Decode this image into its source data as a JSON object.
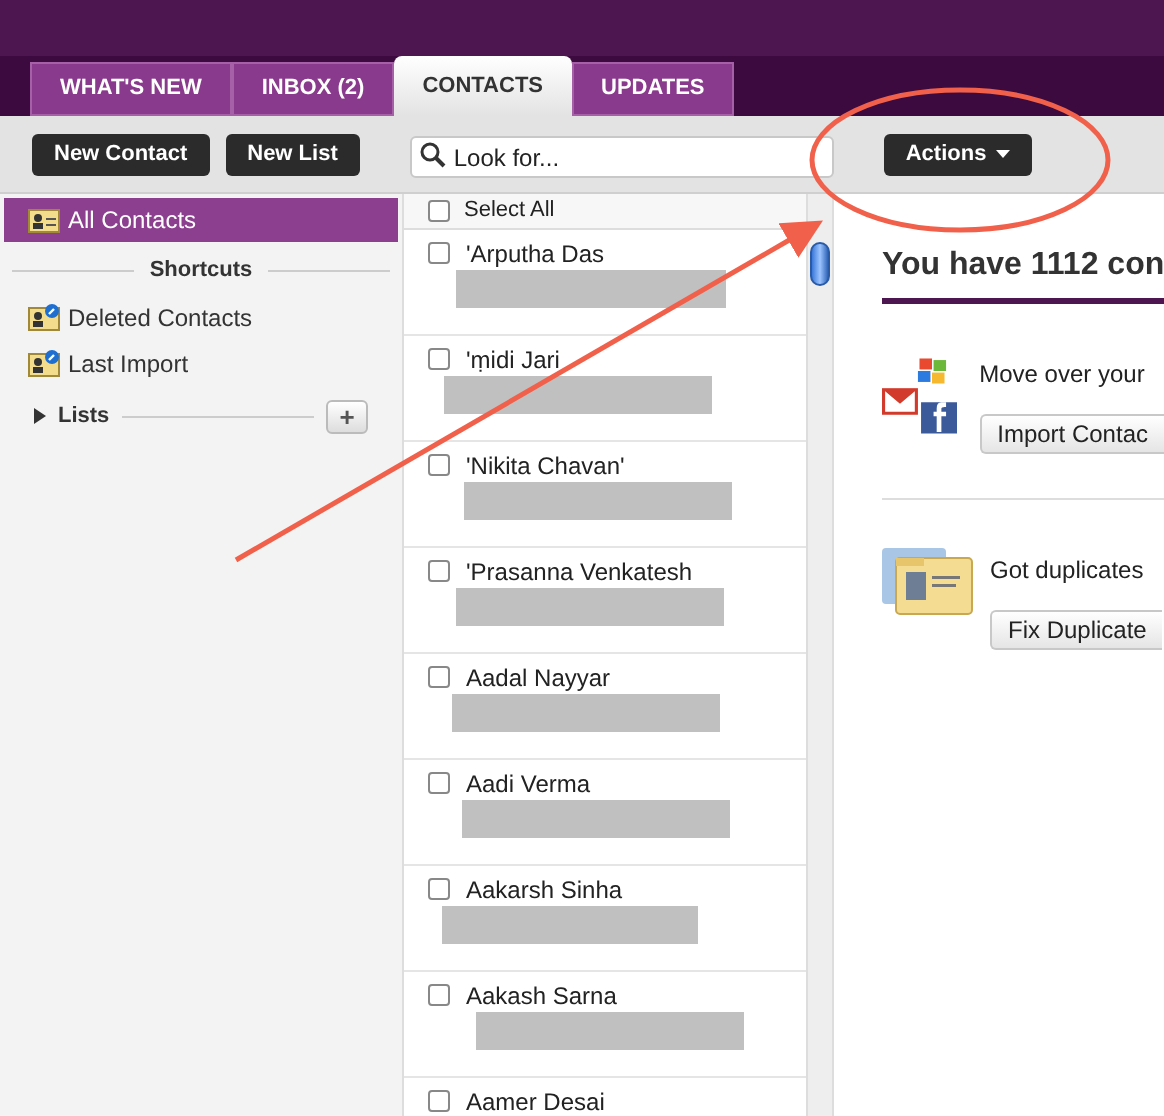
{
  "tabs": [
    {
      "label": "WHAT'S NEW",
      "selected": false
    },
    {
      "label": "INBOX (2)",
      "selected": false
    },
    {
      "label": "CONTACTS",
      "selected": true
    },
    {
      "label": "UPDATES",
      "selected": false
    }
  ],
  "toolbar": {
    "buttons": [
      "New Contact",
      "New List"
    ],
    "search": {
      "placeholder": "Look for..."
    },
    "actions": "Actions"
  },
  "sidebar": {
    "all": {
      "label": "All Contacts",
      "selected": true
    },
    "shortcuts_heading": "Shortcuts",
    "shortcuts": [
      "Deleted Contacts",
      "Last Import"
    ],
    "lists": {
      "label": "Lists",
      "expanded": false,
      "add": "+"
    }
  },
  "contact_list": {
    "select_all": {
      "label": "Select All",
      "checked": false
    },
    "contacts": [
      {
        "name": "'Arputha Das",
        "checked": false
      },
      {
        "name": "'ṃidi Jari",
        "checked": false
      },
      {
        "name": "'Nikita Chavan'",
        "checked": false
      },
      {
        "name": "'Prasanna Venkatesh",
        "checked": false
      },
      {
        "name": "Aadal Nayyar",
        "checked": false
      },
      {
        "name": "Aadi Verma",
        "checked": false
      },
      {
        "name": "Aakarsh Sinha",
        "checked": false
      },
      {
        "name": "Aakash Sarna",
        "checked": false
      },
      {
        "name": "Aamer Desai",
        "checked": false
      }
    ]
  },
  "panel": {
    "heading": "You have 1112 con",
    "sections": [
      {
        "kind": "import",
        "text": "Move over your",
        "button": "Import Contac"
      },
      {
        "kind": "duplicates",
        "text": "Got duplicates",
        "button": "Fix Duplicate"
      }
    ]
  }
}
